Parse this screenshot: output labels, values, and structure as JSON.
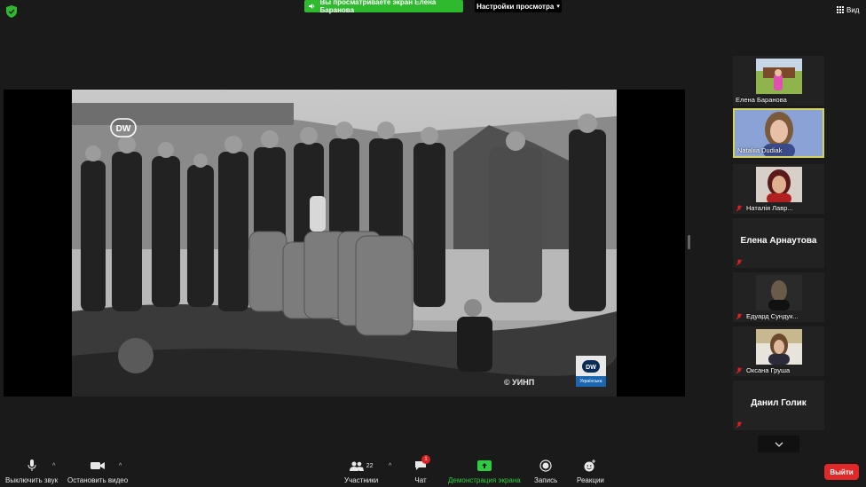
{
  "top_bar": {
    "share_notice": "Вы просматриваете экран Елена Баранова",
    "view_options_label": "Настройки просмотра",
    "view_label": "Вид"
  },
  "shared_screen": {
    "watermark_text": "© УИНП",
    "dw_logo_text": "DW",
    "dw_badge_subtitle": "Українська"
  },
  "participants": [
    {
      "name": "Елена Баранова",
      "muted": false,
      "video": true
    },
    {
      "name": "Nataliia Dudiak",
      "muted": false,
      "video": true,
      "active_speaker": true
    },
    {
      "name": "Наталія Лавр...",
      "muted": true,
      "video": true
    },
    {
      "name": "Елена Арнаутова",
      "muted": true,
      "video": false
    },
    {
      "name": "Едуард Сундук...",
      "muted": true,
      "video": true
    },
    {
      "name": "Оксана Груша",
      "muted": true,
      "video": true
    },
    {
      "name": "Данил Голик",
      "muted": true,
      "video": false
    }
  ],
  "toolbar": {
    "mute_label": "Выключить звук",
    "video_label": "Остановить видео",
    "participants_label": "Участники",
    "participants_count": "22",
    "chat_label": "Чат",
    "chat_badge": "1",
    "share_label": "Демонстрация экрана",
    "record_label": "Запись",
    "reactions_label": "Реакции",
    "leave_label": "Выйти"
  },
  "colors": {
    "share_green": "#2eb92e",
    "active_speaker_border": "#d4d25e",
    "leave_red": "#e02828",
    "muted_red": "#e02020",
    "dw_blue": "#1b66b1"
  }
}
